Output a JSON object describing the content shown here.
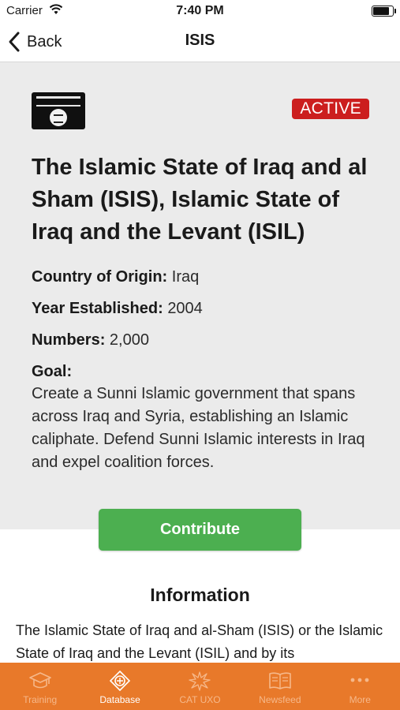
{
  "status_bar": {
    "carrier": "Carrier",
    "time": "7:40 PM",
    "battery_level": 0.9
  },
  "nav": {
    "back_label": "Back",
    "title": "ISIS"
  },
  "group": {
    "status_badge": "ACTIVE",
    "name": "The Islamic State of Iraq and al Sham (ISIS), Islamic State of Iraq and the Levant (ISIL)",
    "country_label": "Country of Origin:",
    "country_value": "Iraq",
    "year_label": "Year Established:",
    "year_value": "2004",
    "numbers_label": "Numbers:",
    "numbers_value": "2,000",
    "goal_label": "Goal:",
    "goal_text": "Create a Sunni Islamic government that spans across Iraq and Syria, establishing an Islamic caliphate. Defend Sunni Islamic interests in Iraq and expel coalition forces."
  },
  "contribute_label": "Contribute",
  "information": {
    "title": "Information",
    "body": "The Islamic State of Iraq and al-Sham (ISIS) or the Islamic State of Iraq and the Levant (ISIL) and by its"
  },
  "tabs": [
    {
      "label": "Training",
      "icon": "graduation-cap-icon",
      "active": false
    },
    {
      "label": "Database",
      "icon": "database-icon",
      "active": true
    },
    {
      "label": "CAT UXO",
      "icon": "explosion-icon",
      "active": false
    },
    {
      "label": "Newsfeed",
      "icon": "book-icon",
      "active": false
    },
    {
      "label": "More",
      "icon": "more-dots-icon",
      "active": false
    }
  ],
  "colors": {
    "tab_bar": "#e8792a",
    "badge": "#cc1e1e",
    "contribute_button": "#4caf50",
    "panel_background": "#ebebeb"
  }
}
